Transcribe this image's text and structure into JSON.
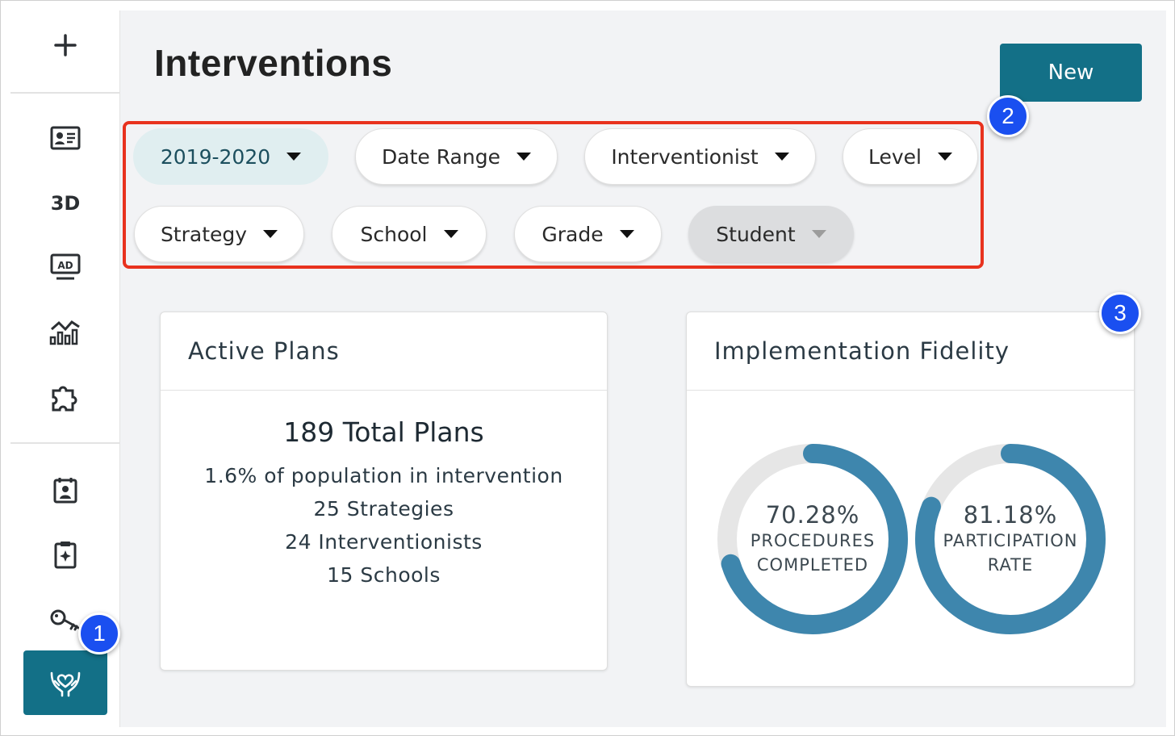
{
  "sidebar": {
    "icons": [
      "plus-icon",
      "id-card-icon",
      "3d-icon",
      "ad-monitor-icon",
      "analytics-chart-icon",
      "puzzle-icon",
      "calendar-student-icon",
      "clipboard-sparkle-icon",
      "key-icon",
      "heart-hands-icon"
    ],
    "three_d_label": "3D",
    "active_item": "heart-hands-icon"
  },
  "header": {
    "title": "Interventions",
    "new_button": "New"
  },
  "filters": [
    {
      "label": "2019-2020",
      "state": "selected"
    },
    {
      "label": "Date Range",
      "state": "default"
    },
    {
      "label": "Interventionist",
      "state": "default"
    },
    {
      "label": "Level",
      "state": "default"
    },
    {
      "label": "Strategy",
      "state": "default"
    },
    {
      "label": "School",
      "state": "default"
    },
    {
      "label": "Grade",
      "state": "default"
    },
    {
      "label": "Student",
      "state": "disabled"
    }
  ],
  "callouts": [
    "1",
    "2",
    "3"
  ],
  "active_plans": {
    "title": "Active Plans",
    "total": "189 Total Plans",
    "lines": [
      "1.6% of population in intervention",
      "25 Strategies",
      "24 Interventionists",
      "15 Schools"
    ]
  },
  "fidelity": {
    "title": "Implementation Fidelity",
    "gauges": [
      {
        "value": 70.28,
        "pct": "70.28%",
        "line1": "PROCEDURES",
        "line2": "COMPLETED"
      },
      {
        "value": 81.18,
        "pct": "81.18%",
        "line1": "PARTICIPATION",
        "line2": "RATE"
      }
    ]
  },
  "colors": {
    "accent": "#137087",
    "gauge_fill": "#3e86ad",
    "gauge_track": "#e6e6e6",
    "highlight_border": "#e8321e",
    "callout_badge": "#1a4ff0",
    "selected_pill": "#e0eef0",
    "disabled_pill": "#dcdddf"
  }
}
